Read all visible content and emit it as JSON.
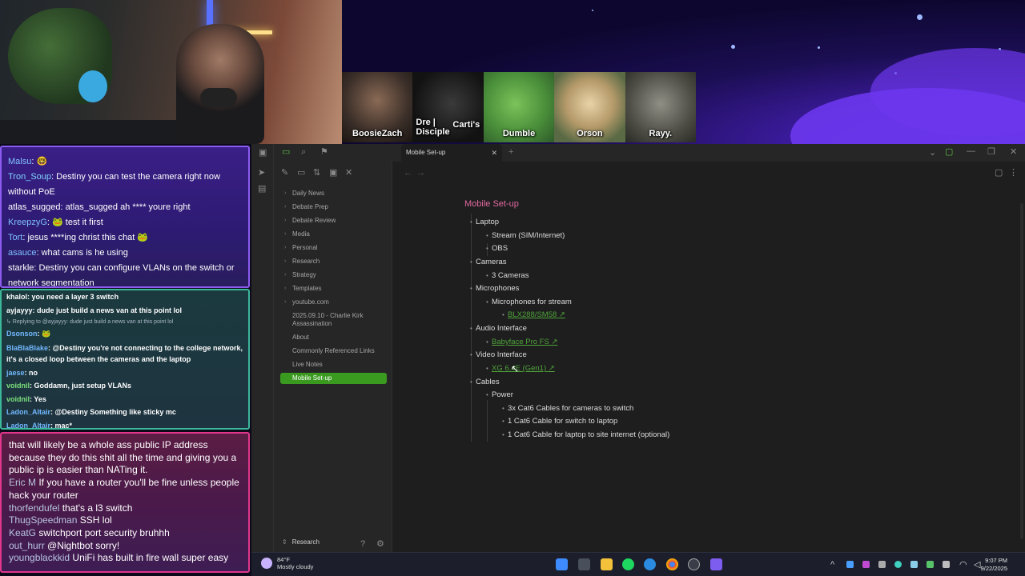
{
  "emotes": [
    {
      "label": "BoosieZach"
    },
    {
      "label": "Dre | Disciple"
    },
    {
      "label": "Carti's"
    },
    {
      "label": "Dumble"
    },
    {
      "label": "Orson"
    },
    {
      "label": "Rayy."
    }
  ],
  "chat_top": [
    {
      "user": "Malsu",
      "text": " 🤓"
    },
    {
      "user": "Tron_Soup",
      "text": " Destiny you can test the camera right now without PoE"
    },
    {
      "user": "atlas_sugged",
      "text": " atlas_sugged ah **** youre right"
    },
    {
      "user": "KreepzyG",
      "text": " 🐸 test it first"
    },
    {
      "user": "Tort",
      "text": " jesus ****ing christ this chat 🐸"
    },
    {
      "user": "asauce",
      "text": " what cams is he using"
    },
    {
      "user": "starkle",
      "text": " Destiny you can configure VLANs on the switch or network segmentation"
    }
  ],
  "chat_mid": [
    {
      "user": "khalol",
      "text": " you need a layer 3 switch"
    },
    {
      "user": "ayjayyy",
      "text": " dude just build a news van at this point lol"
    },
    {
      "reply": "↳ Replying to @ayjayyy: dude just build a news van at this point lol"
    },
    {
      "user": "Dsonson",
      "text": " 🐸"
    },
    {
      "user": "BlaBlaBlake",
      "text": " @Destiny you're not connecting to the college network, it's a closed loop between the cameras and the laptop"
    },
    {
      "user": "jaese",
      "text": " no"
    },
    {
      "user": "voidnil",
      "text": " Goddamn, just setup VLANs"
    },
    {
      "user": "voidnil",
      "text": " Yes"
    },
    {
      "user": "Ladon_Altair",
      "text": " @Destiny Something like sticky mc"
    },
    {
      "user": "Ladon_Altair",
      "text": " mac*"
    }
  ],
  "chat_bottom": [
    {
      "user": "",
      "text": "that will likely be a whole ass public IP address because they do this shit all the time and giving you a public ip is easier than NATing it."
    },
    {
      "user": "Eric M",
      "text": " If you have a router you'll be fine unless people hack your router"
    },
    {
      "user": "thorfendufel",
      "text": " that's a l3 switch"
    },
    {
      "user": "ThugSpeedman",
      "text": " SSH lol"
    },
    {
      "user": "KeatG",
      "text": " switchport port security bruhhh"
    },
    {
      "user": "out_hurr",
      "text": " @Nightbot sorry!"
    },
    {
      "user": "youngblackkid",
      "text": " UniFi has built in fire wall super easy"
    }
  ],
  "obsidian": {
    "tab_title": "Mobile Set-up",
    "vault_name": "Research",
    "sidebar": [
      {
        "label": "Daily News",
        "folder": true
      },
      {
        "label": "Debate Prep",
        "folder": true
      },
      {
        "label": "Debate Review",
        "folder": true
      },
      {
        "label": "Media",
        "folder": true
      },
      {
        "label": "Personal",
        "folder": true
      },
      {
        "label": "Research",
        "folder": true
      },
      {
        "label": "Strategy",
        "folder": true
      },
      {
        "label": "Templates",
        "folder": true
      },
      {
        "label": "youtube.com",
        "folder": true
      },
      {
        "label": "2025.09.10 - Charlie Kirk Assassination",
        "folder": false
      },
      {
        "label": "About",
        "folder": false
      },
      {
        "label": "Commonly Referenced Links",
        "folder": false
      },
      {
        "label": "Live Notes",
        "folder": false
      },
      {
        "label": "Mobile Set-up",
        "folder": false,
        "selected": true
      }
    ],
    "note": {
      "title": "Mobile Set-up",
      "bullets": [
        {
          "text": "Laptop",
          "level": 0
        },
        {
          "text": "Stream (SIM/Internet)",
          "level": 1
        },
        {
          "text": "OBS",
          "level": 1
        },
        {
          "text": "Cameras",
          "level": 0
        },
        {
          "text": "3 Cameras",
          "level": 1
        },
        {
          "text": "Microphones",
          "level": 0
        },
        {
          "text": "Microphones for stream",
          "level": 1
        },
        {
          "text": "BLX288/SM58",
          "level": 2,
          "link": true
        },
        {
          "text": "Audio Interface",
          "level": 0
        },
        {
          "text": "Babyface Pro FS",
          "level": 1,
          "link": true
        },
        {
          "text": "Video Interface",
          "level": 0
        },
        {
          "text": "XG 6.4E (Gen1)",
          "level": 1,
          "link": true
        },
        {
          "text": "Cables",
          "level": 0
        },
        {
          "text": "Power",
          "level": 1
        },
        {
          "text": "3x Cat6 Cables for cameras to switch",
          "level": 2
        },
        {
          "text": "1 Cat6 Cable for switch to laptop",
          "level": 2
        },
        {
          "text": "1 Cat6 Cable for laptop to site internet (optional)",
          "level": 2
        }
      ]
    }
  },
  "taskbar": {
    "weather_temp": "84°F",
    "weather_desc": "Mostly cloudy",
    "time": "9:07 PM",
    "date": "9/22/2025"
  },
  "colors": {
    "accent": "#3a9a20",
    "note_title": "#e06aa0",
    "link": "#4fa33b"
  }
}
